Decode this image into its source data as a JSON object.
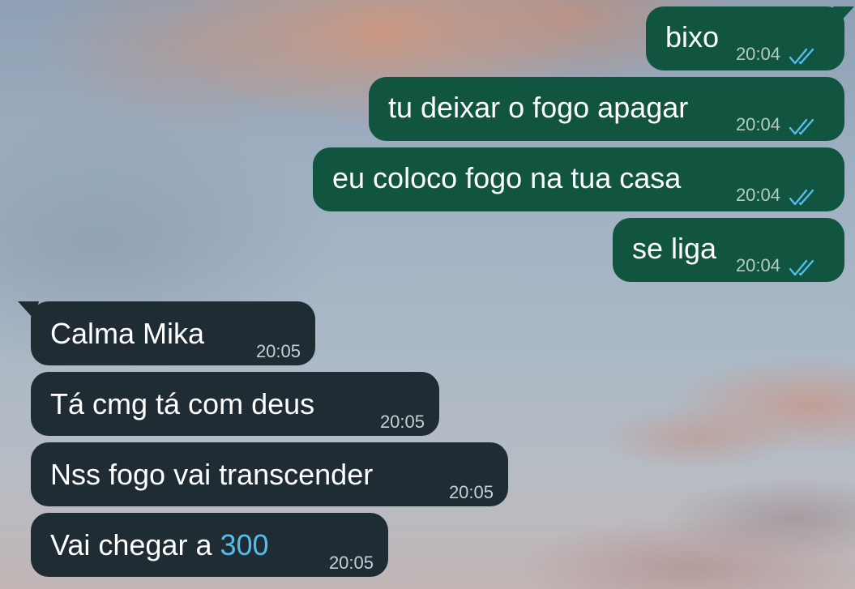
{
  "chat": {
    "outgoing": [
      {
        "text": "bixo",
        "time": "20:04",
        "status": "read-double-check-icon"
      },
      {
        "text": "tu deixar o fogo apagar",
        "time": "20:04",
        "status": "read-double-check-icon"
      },
      {
        "text": "eu coloco fogo na tua casa",
        "time": "20:04",
        "status": "read-double-check-icon"
      },
      {
        "text": "se liga",
        "time": "20:04",
        "status": "read-double-check-icon"
      }
    ],
    "incoming": [
      {
        "text": "Calma Mika",
        "time": "20:05"
      },
      {
        "text": "Tá cmg tá com deus",
        "time": "20:05"
      },
      {
        "text": "Nss fogo vai transcender",
        "time": "20:05"
      },
      {
        "text_before": "Vai chegar a ",
        "number": "300",
        "time": "20:05"
      }
    ]
  },
  "colors": {
    "outgoing_bubble": "#115440",
    "incoming_bubble": "#1f2c34",
    "read_ticks": "#53bdeb",
    "link_number": "#53bdeb"
  }
}
